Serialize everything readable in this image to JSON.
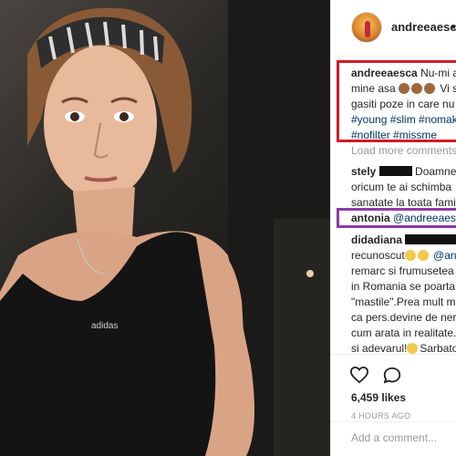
{
  "post": {
    "username": "andreeaesca",
    "dot": "•"
  },
  "caption": {
    "user": "andreeaesca",
    "line1_text": "Nu-mi ar",
    "line2_text": "mine asa",
    "line2_end": "Vi s",
    "line3": "gasiti poze in care nu v",
    "line4": "#young #slim #nomak",
    "line5": "#nofilter #missme"
  },
  "load_more": "Load more comments",
  "comments": [
    {
      "user": "stely",
      "line1_text": "Doamne",
      "line2": "oricum te ai schimba",
      "line3": "sanatate la toata famil"
    },
    {
      "user": "antonia",
      "mention": "@andreeaesca"
    },
    {
      "user": "didadiana",
      "line1": "recunoscut",
      "line1_mention": "@an",
      "line2": "remarc si frumusetea n",
      "line3": "in Romania se poarta s",
      "line4": "\"mastile\".Prea mult ma",
      "line5": "ca pers.devine de nere",
      "line6": "cum arata in realitate.",
      "line7": "si adevarul!",
      "line7_end": "Sarbato"
    }
  ],
  "stats": {
    "likes": "6,459 likes",
    "time": "4 HOURS AGO"
  },
  "add_comment": {
    "placeholder": "Add a comment..."
  },
  "icons": {
    "like": "heart-icon",
    "comment": "comment-bubble-icon"
  },
  "colors": {
    "highlight_red": "#d11a2a",
    "highlight_purple": "#8e3aa6",
    "hashtag": "#003569"
  }
}
